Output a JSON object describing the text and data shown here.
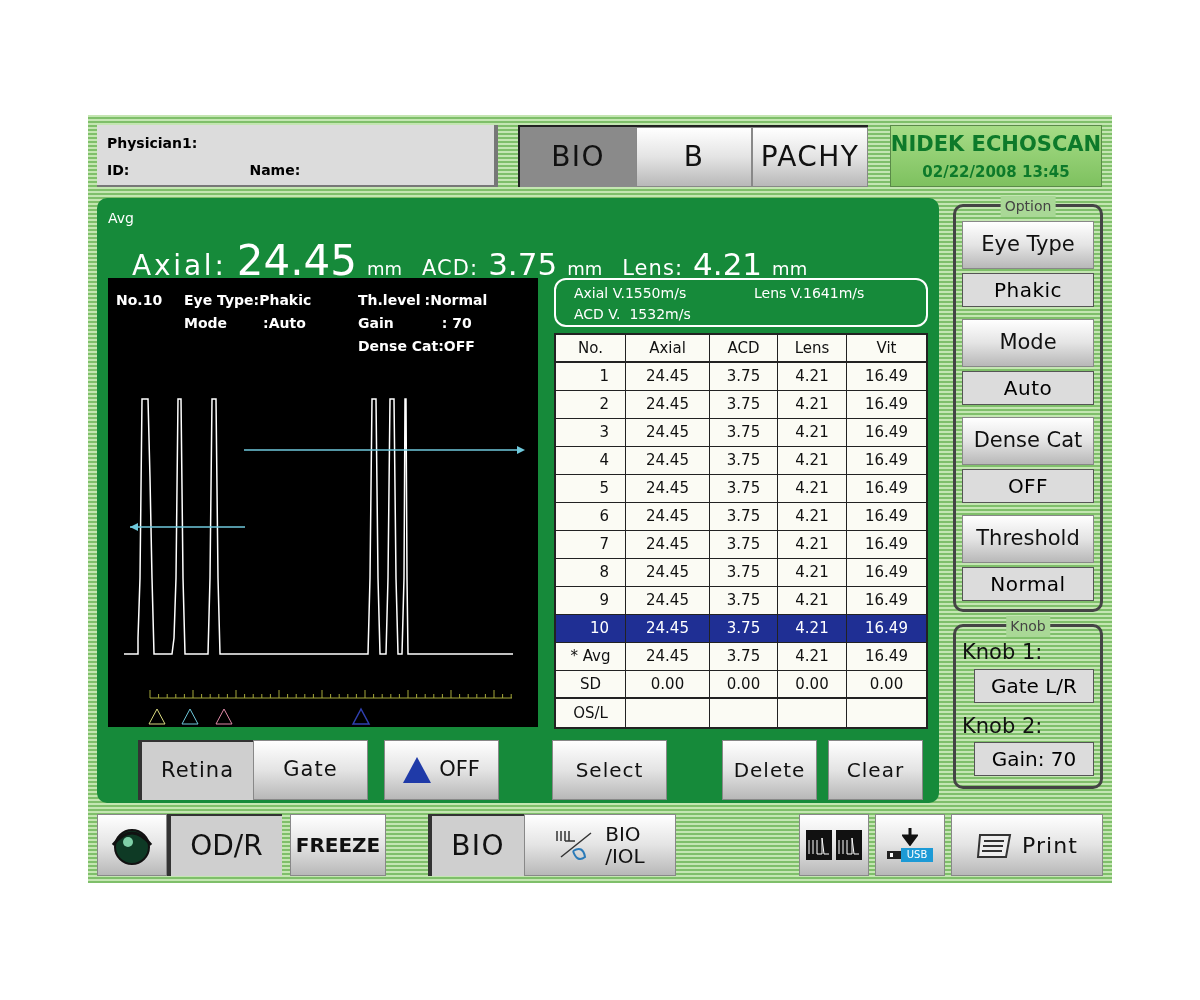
{
  "patient": {
    "physician": "Physician1:",
    "id": "ID:",
    "name": "Name:"
  },
  "mode_tabs": [
    {
      "label": "BIO",
      "selected": true
    },
    {
      "label": "B",
      "selected": false
    },
    {
      "label": "PACHY",
      "selected": false
    }
  ],
  "brand": {
    "name": "NIDEK ECHOSCAN",
    "datetime": "02/22/2008 13:45"
  },
  "summary": {
    "label": "Avg",
    "measurements": [
      {
        "label": "Axial:",
        "value": "24.45",
        "unit": "mm",
        "kind": "large"
      },
      {
        "label": "ACD:",
        "value": "3.75",
        "unit": "mm",
        "kind": "normal"
      },
      {
        "label": "Lens:",
        "value": "4.21",
        "unit": "mm",
        "kind": "normal"
      }
    ]
  },
  "scan_info": {
    "number": "No.10",
    "eye_type": "Eye Type:Phakic",
    "mode_label": "Mode",
    "mode_value": ":Auto",
    "threshold_label": "Th.level",
    "threshold_value": ":Normal",
    "gain_label": "Gain",
    "gain_value": ": 70",
    "dense_cat": "Dense Cat:OFF"
  },
  "velocities": [
    "Axial V.1550m/s",
    "Lens V.1641m/s",
    "ACD V.  1532m/s"
  ],
  "table": {
    "columns": [
      "No.",
      "Axial",
      "ACD",
      "Lens",
      "Vit"
    ],
    "rows": [
      {
        "cells": [
          "1",
          "24.45",
          "3.75",
          "4.21",
          "16.49"
        ],
        "selected": false
      },
      {
        "cells": [
          "2",
          "24.45",
          "3.75",
          "4.21",
          "16.49"
        ],
        "selected": false
      },
      {
        "cells": [
          "3",
          "24.45",
          "3.75",
          "4.21",
          "16.49"
        ],
        "selected": false
      },
      {
        "cells": [
          "4",
          "24.45",
          "3.75",
          "4.21",
          "16.49"
        ],
        "selected": false
      },
      {
        "cells": [
          "5",
          "24.45",
          "3.75",
          "4.21",
          "16.49"
        ],
        "selected": false
      },
      {
        "cells": [
          "6",
          "24.45",
          "3.75",
          "4.21",
          "16.49"
        ],
        "selected": false
      },
      {
        "cells": [
          "7",
          "24.45",
          "3.75",
          "4.21",
          "16.49"
        ],
        "selected": false
      },
      {
        "cells": [
          "8",
          "24.45",
          "3.75",
          "4.21",
          "16.49"
        ],
        "selected": false
      },
      {
        "cells": [
          "9",
          "24.45",
          "3.75",
          "4.21",
          "16.49"
        ],
        "selected": false
      },
      {
        "cells": [
          "10",
          "24.45",
          "3.75",
          "4.21",
          "16.49"
        ],
        "selected": true
      }
    ],
    "summary_rows": [
      {
        "cells": [
          "* Avg",
          "24.45",
          "3.75",
          "4.21",
          "16.49"
        ]
      },
      {
        "cells": [
          "SD",
          "0.00",
          "0.00",
          "0.00",
          "0.00"
        ]
      },
      {
        "cells": [
          "OS/L"
        ]
      }
    ]
  },
  "gate_toggle": [
    {
      "label": "Retina",
      "selected": true
    },
    {
      "label": "Gate",
      "selected": false
    }
  ],
  "marker_button": {
    "label": "OFF"
  },
  "actions": [
    "Select",
    "Delete",
    "Clear"
  ],
  "option_group": {
    "title": "Option",
    "items": [
      {
        "label": "Eye Type",
        "value": "Phakic"
      },
      {
        "label": "Mode",
        "value": "Auto"
      },
      {
        "label": "Dense Cat",
        "value": "OFF"
      },
      {
        "label": "Threshold",
        "value": "Normal"
      }
    ]
  },
  "knob_group": {
    "title": "Knob",
    "items": [
      {
        "label": "Knob 1:",
        "value": "Gate L/R"
      },
      {
        "label": "Knob 2:",
        "value": "Gain: 70"
      }
    ]
  },
  "bottom_bar": {
    "eye_side": {
      "label": "OD/R",
      "pressed": true
    },
    "freeze": "FREEZE",
    "calc_tabs": [
      {
        "label": "BIO",
        "selected": true
      },
      {
        "label": "BIO\n/IOL",
        "selected": false
      }
    ],
    "usb_label": "USB",
    "print": "Print"
  }
}
